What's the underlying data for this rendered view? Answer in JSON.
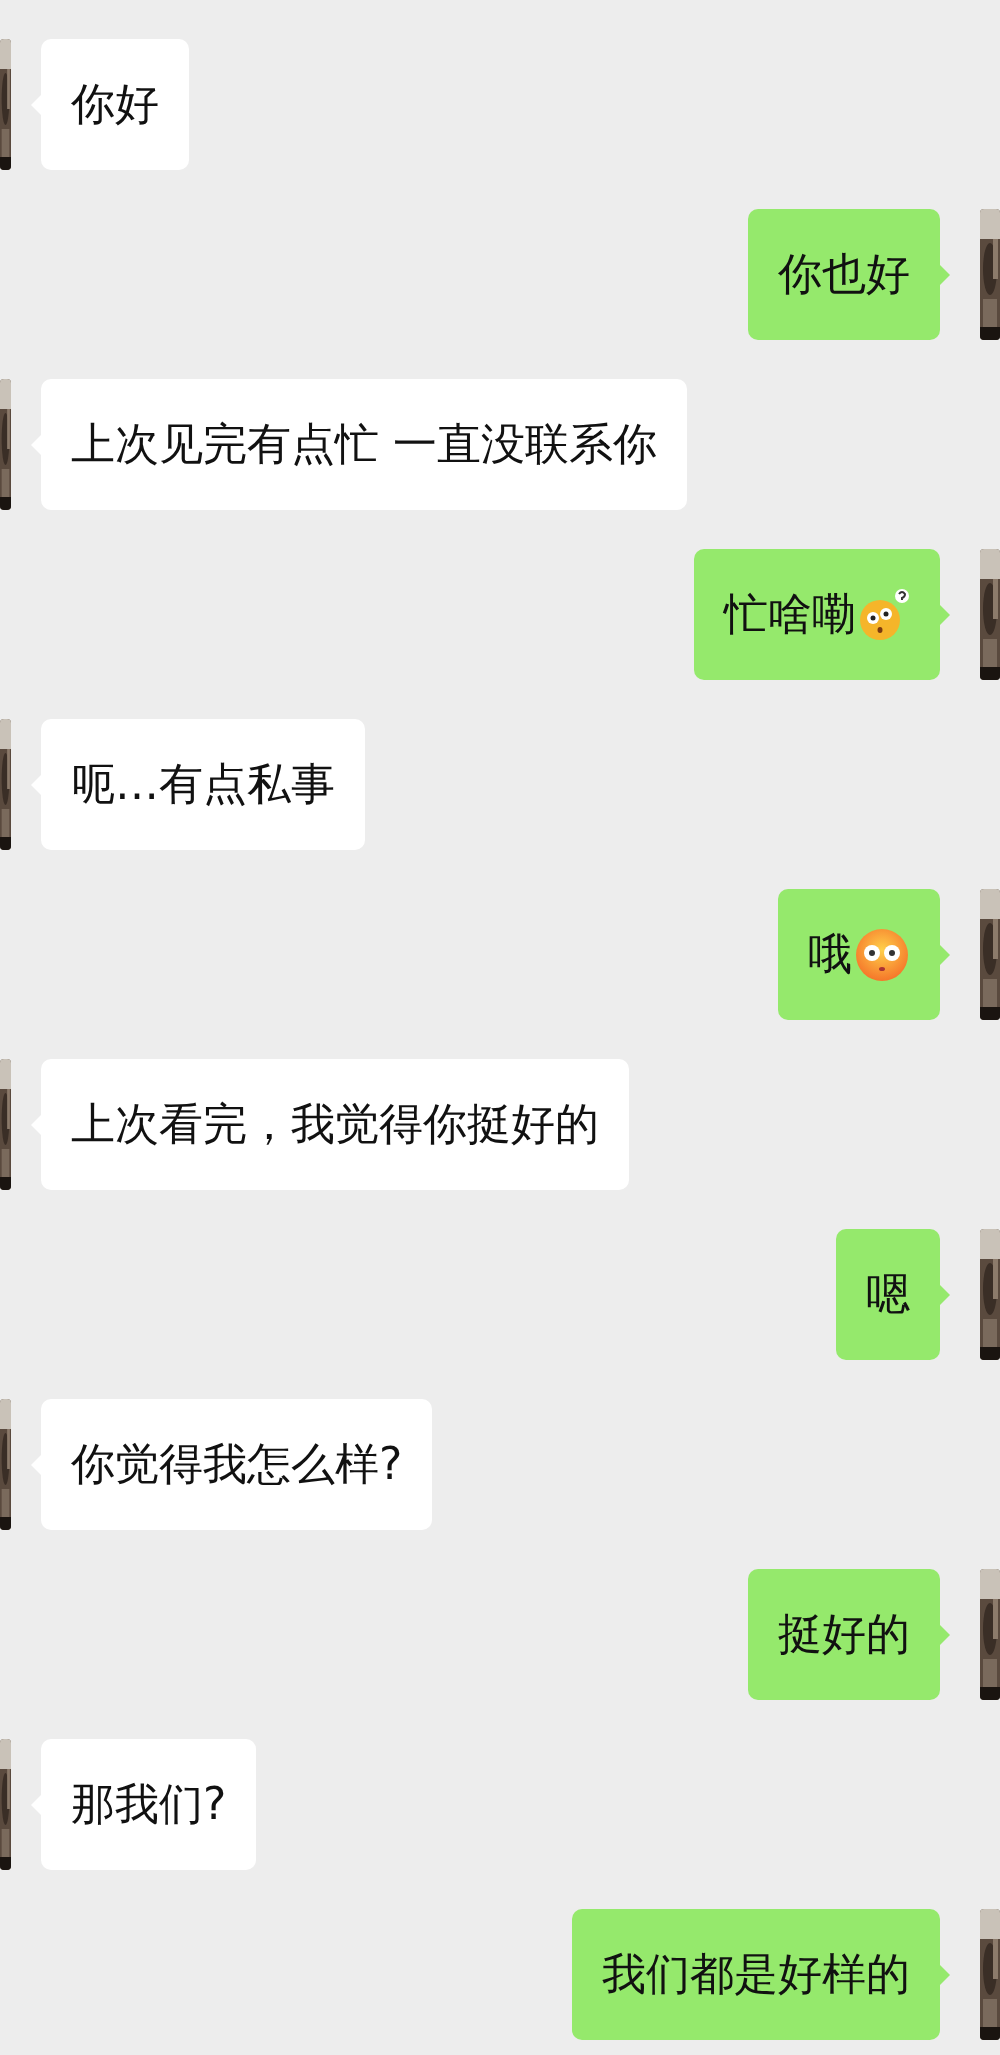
{
  "messages": [
    {
      "kind": "received",
      "text": "你好"
    },
    {
      "kind": "sent",
      "text": "你也好"
    },
    {
      "kind": "received",
      "text": "上次见完有点忙 一直没联系你"
    },
    {
      "kind": "sent",
      "text": "忙啥嘞",
      "emoji": {
        "kind": "puzzled"
      }
    },
    {
      "kind": "received",
      "text": "呃…有点私事"
    },
    {
      "kind": "sent",
      "text": "哦",
      "emoji": {
        "kind": "flushed"
      }
    },
    {
      "kind": "received",
      "text": "上次看完，我觉得你挺好的"
    },
    {
      "kind": "sent",
      "text": "嗯"
    },
    {
      "kind": "received",
      "text": "你觉得我怎么样?"
    },
    {
      "kind": "sent",
      "text": "挺好的"
    },
    {
      "kind": "received",
      "text": "那我们?"
    },
    {
      "kind": "sent",
      "text": "我们都是好样的"
    }
  ]
}
